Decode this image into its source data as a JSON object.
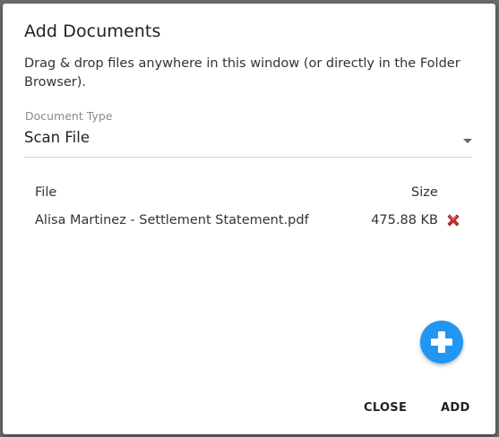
{
  "dialog": {
    "title": "Add Documents",
    "instructions": "Drag & drop files anywhere in this window (or directly in the Folder Browser)."
  },
  "document_type": {
    "label": "Document Type",
    "value": "Scan File",
    "dropdown_icon": "caret-down-icon"
  },
  "files": {
    "headers": {
      "file": "File",
      "size": "Size"
    },
    "rows": [
      {
        "name": "Alisa Martinez - Settlement Statement.pdf",
        "size": "475.88 KB",
        "remove_icon": "red-x-icon"
      }
    ]
  },
  "add_file_button": {
    "icon": "plus-icon",
    "color": "#2196f3"
  },
  "actions": {
    "close_label": "CLOSE",
    "add_label": "ADD"
  }
}
